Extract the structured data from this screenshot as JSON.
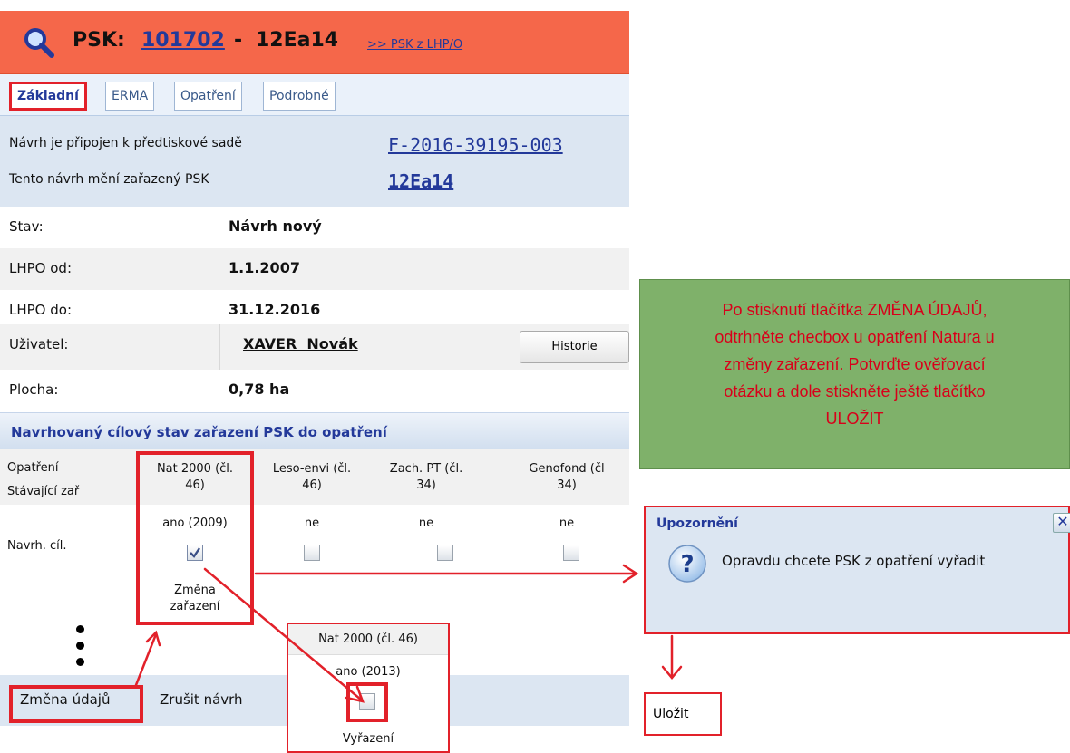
{
  "header": {
    "label": "PSK:",
    "psk_id": "101702",
    "separator": "-",
    "code": "12Ea14",
    "link": ">> PSK z LHP/O"
  },
  "tabs": [
    "Základní",
    "ERMA",
    "Opatření",
    "Podrobné"
  ],
  "attach": {
    "line1": "Návrh je připojen k předtiskové sadě",
    "set_link": "F-2016-39195-003",
    "line2": "Tento návrh mění zařazený PSK",
    "psk_link": "12Ea14"
  },
  "info": [
    {
      "label": "Stav:",
      "value": "Návrh nový"
    },
    {
      "label": "LHPO od:",
      "value": "1.1.2007"
    },
    {
      "label": "LHPO do:",
      "value": "31.12.2016"
    },
    {
      "label": "Uživatel:",
      "value": "XAVER  Novák"
    },
    {
      "label": "Plocha:",
      "value": "0,78 ha"
    }
  ],
  "history_button": "Historie",
  "section_title": "Navrhovaný cílový stav zařazení PSK do opatření",
  "grid": {
    "row_labels": [
      "Opatření",
      "Stávající zař",
      "Navrh. cíl."
    ],
    "columns": [
      {
        "name_l1": "Nat 2000 (čl.",
        "name_l2": "46)",
        "current": "ano (2009)",
        "checked": true,
        "note_l1": "Změna",
        "note_l2": "zařazení"
      },
      {
        "name_l1": "Leso-envi (čl.",
        "name_l2": "46)",
        "current": "ne",
        "checked": false
      },
      {
        "name_l1": "Zach. PT (čl.",
        "name_l2": "34)",
        "current": "ne",
        "checked": false
      },
      {
        "name_l1": "Genofond (čl",
        "name_l2": "34)",
        "current": "ne",
        "checked": false
      }
    ]
  },
  "bottom_buttons": [
    "Změna údajů",
    "Zrušit návrh"
  ],
  "popup": {
    "title": "Nat 2000 (čl. 46)",
    "current": "ano (2013)",
    "checked": false,
    "note": "Vyřazení"
  },
  "note_box": {
    "lines": [
      "Po stisknutí tlačítka ZMĚNA ÚDAJŮ,",
      "odtrhněte checbox u opatření Natura u",
      "změny zařazení. Potvrďte ověřovací",
      "otázku a dole stiskněte ještě tlačítko",
      "ULOŽIT"
    ]
  },
  "dialog": {
    "title": "Upozornění",
    "close": "✕",
    "message": "Opravdu chcete PSK z opatření vyřadit"
  },
  "save_button": "Uložit",
  "colors": {
    "header_bg": "#f5674a",
    "accent_red": "#e2212a",
    "link_blue": "#23399a",
    "note_bg": "#7fb16a",
    "note_text": "#d8001a"
  }
}
